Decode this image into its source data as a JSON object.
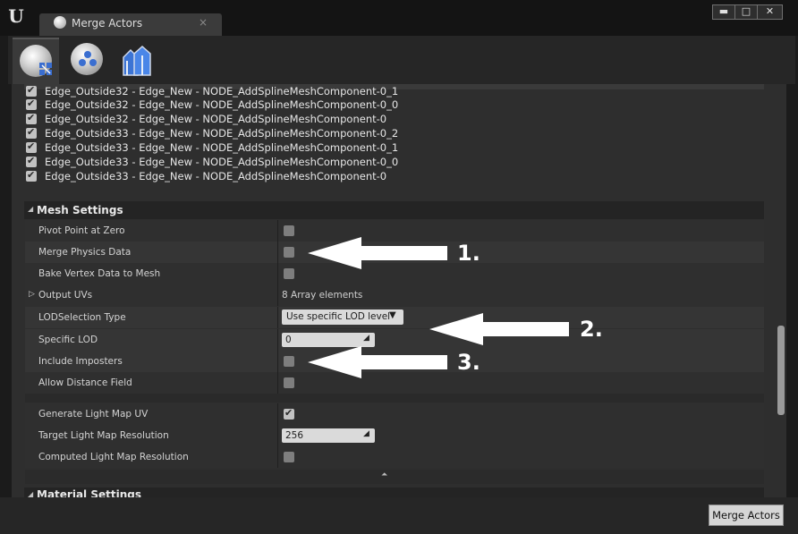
{
  "window": {
    "tab_title": "Merge Actors",
    "tab_close": "×",
    "minimize": "▬",
    "maximize": "□",
    "close": "✕"
  },
  "toolbar": {
    "tools": [
      "merge-actors-tool",
      "proxy-mesh-tool",
      "hlod-instancing-tool"
    ]
  },
  "component_list": [
    {
      "label": "Edge_Outside32 - Edge_New - NODE_AddSplineMeshComponent-0_1",
      "checked": true
    },
    {
      "label": "Edge_Outside32 - Edge_New - NODE_AddSplineMeshComponent-0_0",
      "checked": true
    },
    {
      "label": "Edge_Outside32 - Edge_New - NODE_AddSplineMeshComponent-0",
      "checked": true
    },
    {
      "label": "Edge_Outside33 - Edge_New - NODE_AddSplineMeshComponent-0_2",
      "checked": true
    },
    {
      "label": "Edge_Outside33 - Edge_New - NODE_AddSplineMeshComponent-0_1",
      "checked": true
    },
    {
      "label": "Edge_Outside33 - Edge_New - NODE_AddSplineMeshComponent-0_0",
      "checked": true
    },
    {
      "label": "Edge_Outside33 - Edge_New - NODE_AddSplineMeshComponent-0",
      "checked": true
    }
  ],
  "mesh_settings": {
    "header": "Mesh Settings",
    "pivot_point_at_zero": {
      "label": "Pivot Point at Zero",
      "checked": false
    },
    "merge_physics_data": {
      "label": "Merge Physics Data",
      "checked": false
    },
    "bake_vertex_data": {
      "label": "Bake Vertex Data to Mesh",
      "checked": false
    },
    "output_uvs": {
      "label": "Output UVs",
      "value": "8 Array elements"
    },
    "lod_selection_type": {
      "label": "LODSelection Type",
      "value": "Use specific LOD level"
    },
    "specific_lod": {
      "label": "Specific LOD",
      "value": "0"
    },
    "include_imposters": {
      "label": "Include Imposters",
      "checked": false
    },
    "allow_distance_field": {
      "label": "Allow Distance Field",
      "checked": false
    },
    "generate_light_map_uv": {
      "label": "Generate Light Map UV",
      "checked": true
    },
    "target_light_map_resolution": {
      "label": "Target Light Map Resolution",
      "value": "256"
    },
    "computed_light_map_resolution": {
      "label": "Computed Light Map Resolution",
      "checked": false
    }
  },
  "material_settings": {
    "header": "Material Settings"
  },
  "footer": {
    "merge_button": "Merge Actors"
  },
  "annotations": {
    "one": "1.",
    "two": "2.",
    "three": "3."
  }
}
